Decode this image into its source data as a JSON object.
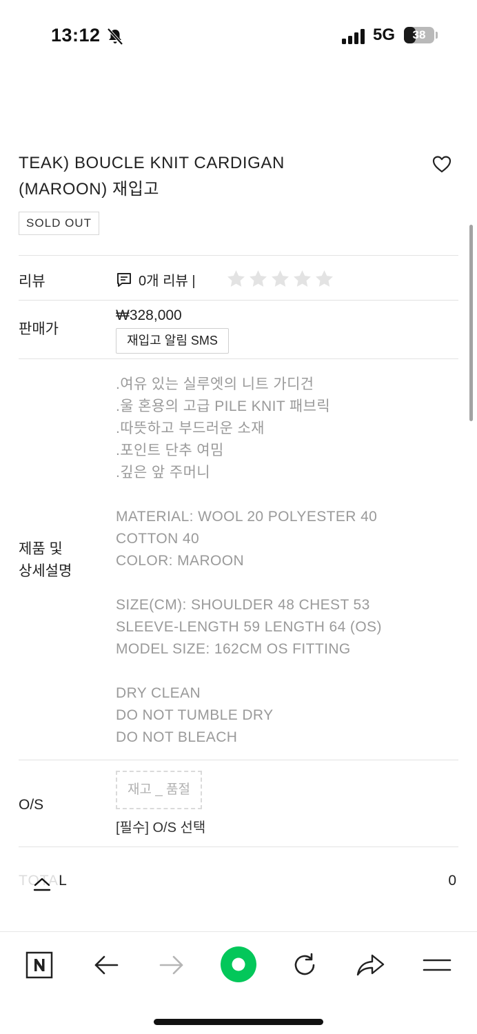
{
  "status_bar": {
    "time": "13:12",
    "network": "5G",
    "battery_level": "38",
    "battery_fraction": 0.38
  },
  "product": {
    "title_line1": "TEAK) BOUCLE KNIT CARDIGAN",
    "title_line2": "(MAROON) 재입고",
    "badge": "SOLD OUT"
  },
  "rows": {
    "review": {
      "label": "리뷰",
      "count_text": "0개 리뷰 |",
      "rating": 0,
      "max_rating": 5
    },
    "price": {
      "label": "판매가",
      "value": "₩328,000",
      "restock_button": "재입고 알림 SMS"
    },
    "details": {
      "label_line1": "제품 및",
      "label_line2": "상세설명",
      "lines": [
        ".여유 있는 실루엣의 니트 가디건",
        ".울 혼용의 고급 PILE KNIT 패브릭",
        ".따뜻하고 부드러운 소재",
        ".포인트 단추 여밈",
        ".깊은 앞 주머니",
        "",
        "MATERIAL: WOOL 20 POLYESTER 40",
        "COTTON 40",
        "COLOR: MAROON",
        "",
        "SIZE(CM): SHOULDER 48 CHEST 53",
        "SLEEVE-LENGTH 59 LENGTH 64 (OS)",
        "MODEL SIZE: 162CM OS FITTING",
        "",
        "DRY CLEAN",
        "DO NOT TUMBLE DRY",
        "DO NOT BLEACH"
      ]
    },
    "option": {
      "label": "O/S",
      "chip": "재고 _ 품절",
      "required_text": "[필수] O/S 선택"
    },
    "total": {
      "label_faded": "TOTA",
      "label_visible": "L",
      "value": "0"
    }
  },
  "toolbar": {
    "items": [
      "naver-home",
      "back",
      "forward",
      "green-dot",
      "reload",
      "share",
      "menu"
    ]
  },
  "colors": {
    "text": "#222222",
    "muted_text": "#9a9a9a",
    "divider": "#e2e2e2",
    "star_empty": "#e3e3e3",
    "accent_green": "#03c75a"
  }
}
